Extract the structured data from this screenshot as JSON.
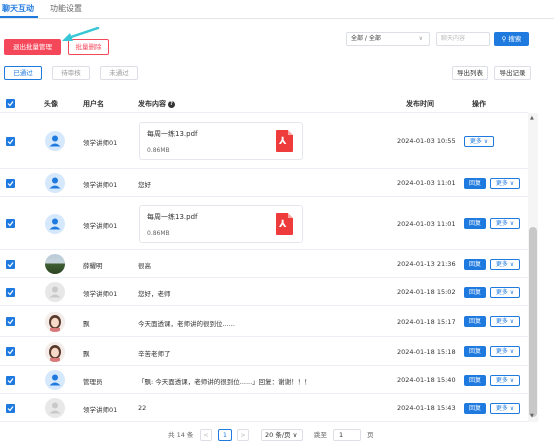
{
  "tabs": [
    {
      "label": "聊天互动",
      "active": true
    },
    {
      "label": "功能设置",
      "active": false
    }
  ],
  "toolbar": {
    "exit_batch_label": "退出批量管理",
    "batch_delete_label": "批量删除",
    "filter_select_value": "全部 / 全部",
    "search_placeholder": "聊天内容",
    "search_button_label": "搜索"
  },
  "filters": {
    "approved": "已通过",
    "pending": "待审核",
    "rejected": "未通过"
  },
  "exports": {
    "export_list": "导出列表",
    "export_records": "导出记录"
  },
  "table": {
    "headers": {
      "avatar": "头像",
      "username": "用户名",
      "content": "发布内容",
      "time": "发布时间",
      "operation": "操作"
    },
    "reply_label": "回复",
    "more_label": "更多",
    "rows": [
      {
        "username": "领学讲师01",
        "type": "file",
        "file_name": "每周一练13.pdf",
        "file_size": "0.86MB",
        "time": "2024-01-03 10:55",
        "has_reply": false,
        "avatar": "blue-user"
      },
      {
        "username": "领学讲师01",
        "type": "text",
        "content": "您好",
        "time": "2024-01-03 11:01",
        "has_reply": true,
        "avatar": "blue-user"
      },
      {
        "username": "领学讲师01",
        "type": "file",
        "file_name": "每周一练13.pdf",
        "file_size": "0.86MB",
        "time": "2024-01-03 11:01",
        "has_reply": true,
        "avatar": "blue-user"
      },
      {
        "username": "薛耀明",
        "type": "text",
        "content": "很高",
        "time": "2024-01-13 21:36",
        "has_reply": true,
        "avatar": "landscape"
      },
      {
        "username": "领学讲师01",
        "type": "text",
        "content": "您好，老师",
        "time": "2024-01-18 15:02",
        "has_reply": true,
        "avatar": "grey-user"
      },
      {
        "username": "飘",
        "type": "text",
        "content": "今天面透课，老师讲的很到位......",
        "time": "2024-01-18 15:17",
        "has_reply": true,
        "avatar": "photo"
      },
      {
        "username": "飘",
        "type": "text",
        "content": "辛苦老师了",
        "time": "2024-01-18 15:18",
        "has_reply": true,
        "avatar": "photo"
      },
      {
        "username": "管理员",
        "type": "text",
        "content": "「飘: 今天面透课，老师讲的很到位......」回复：谢谢！！！",
        "time": "2024-01-18 15:40",
        "has_reply": true,
        "avatar": "blue-user"
      },
      {
        "username": "领学讲师01",
        "type": "text",
        "content": "22",
        "time": "2024-01-18 15:43",
        "has_reply": true,
        "avatar": "grey-user"
      }
    ]
  },
  "pagination": {
    "total": "共 14 条",
    "prev": "<",
    "current": "1",
    "next": ">",
    "page_size": "20 条/页",
    "goto_label": "跳至",
    "goto_value": "1",
    "page_label": "页"
  },
  "colors": {
    "primary": "#1f7ae0",
    "danger": "#f5475a"
  }
}
